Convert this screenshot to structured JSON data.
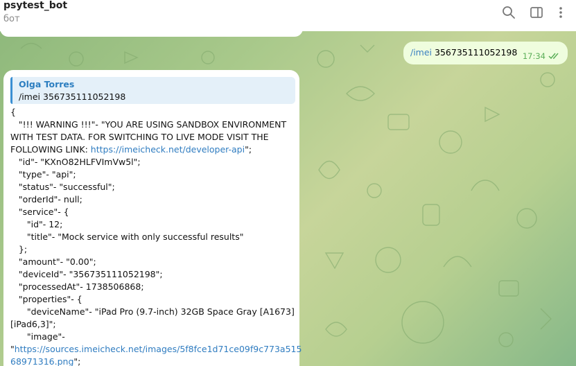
{
  "header": {
    "title": "psytest_bot",
    "subtitle": "бот",
    "icons": [
      "search-icon",
      "sidebar-toggle-icon",
      "more-vertical-icon"
    ]
  },
  "outgoing_message": {
    "command": "/imei",
    "argument": "356735111052198",
    "time": "17:34",
    "status_icon": "double-check-icon"
  },
  "incoming_message": {
    "reply": {
      "name": "Olga Torres",
      "text": "/imei 356735111052198"
    },
    "lines": [
      {
        "indent": "",
        "text": "{"
      },
      {
        "indent": "   ",
        "text": "\"!!! WARNING !!!\"- \"YOU ARE USING SANDBOX ENVIRONMENT"
      },
      {
        "indent": "",
        "text": "WITH TEST DATA. FOR SWITCHING TO LIVE MODE VISIT THE"
      },
      {
        "indent": "",
        "text": "FOLLOWING LINK: ",
        "link": "https://imeicheck.net/developer-api",
        "after": "\";"
      },
      {
        "indent": "   ",
        "text": "\"id\"- \"KXnO82HLFVImVw5l\";"
      },
      {
        "indent": "   ",
        "text": "\"type\"- \"api\";"
      },
      {
        "indent": "   ",
        "text": "\"status\"- \"successful\";"
      },
      {
        "indent": "   ",
        "text": "\"orderId\"- null;"
      },
      {
        "indent": "   ",
        "text": "\"service\"- {"
      },
      {
        "indent": "      ",
        "text": "\"id\"- 12;"
      },
      {
        "indent": "      ",
        "text": "\"title\"- \"Mock service with only successful results\""
      },
      {
        "indent": "   ",
        "text": "};"
      },
      {
        "indent": "   ",
        "text": "\"amount\"- \"0.00\";"
      },
      {
        "indent": "   ",
        "text": "\"deviceId\"- \"356735111052198\";"
      },
      {
        "indent": "   ",
        "text": "\"processedAt\"- 1738506868;"
      },
      {
        "indent": "   ",
        "text": "\"properties\"- {"
      },
      {
        "indent": "      ",
        "text": "\"deviceName\"- \"iPad Pro (9.7-inch) 32GB Space Gray [A1673]"
      },
      {
        "indent": "",
        "text": "[iPad6,3]\";"
      },
      {
        "indent": "      ",
        "text": "\"image\"-"
      },
      {
        "indent": "",
        "text": "\"",
        "link": "https://sources.imeicheck.net/images/5f8fce1d71ce09f9c773a515"
      },
      {
        "indent": "",
        "text": "",
        "link": "68971316.png",
        "after": "\";"
      }
    ]
  },
  "colors": {
    "header_bg": "#ffffff",
    "outgoing_bubble": "#effdde",
    "incoming_bubble": "#ffffff",
    "link": "#2f7cc0",
    "reply_accent": "#3a8fd3",
    "time_green": "#5bae58"
  }
}
